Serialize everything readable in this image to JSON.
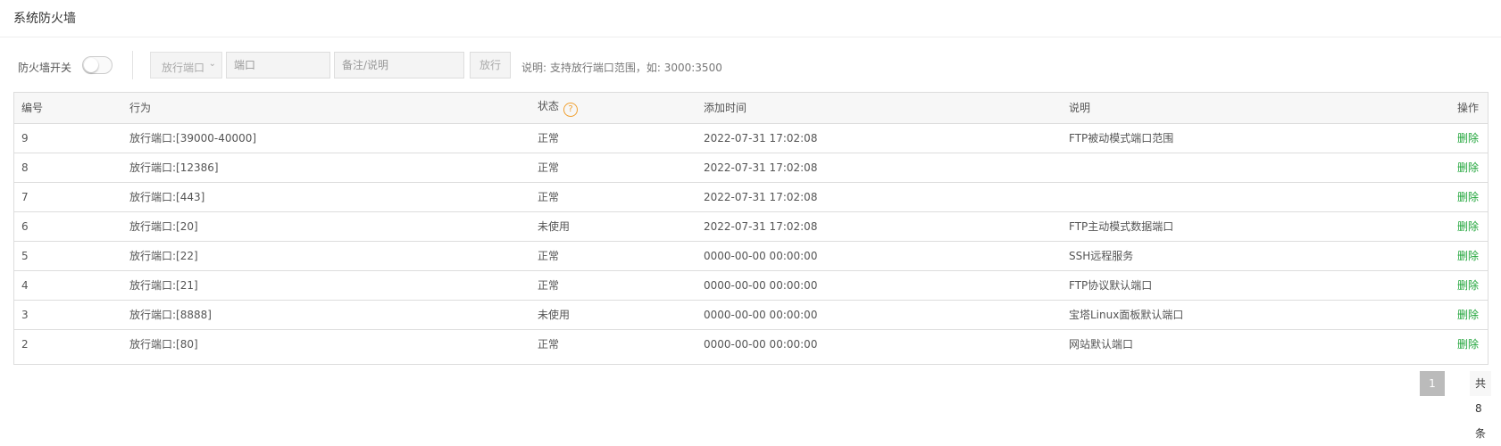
{
  "page_title": "系统防火墙",
  "toolbar": {
    "firewall_switch_label": "防火墙开关",
    "firewall_enabled": false,
    "action_select_value": "放行端口",
    "port_placeholder": "端口",
    "note_placeholder": "备注/说明",
    "release_button": "放行",
    "hint": "说明: 支持放行端口范围，如: 3000:3500"
  },
  "table": {
    "headers": {
      "id": "编号",
      "action": "行为",
      "status": "状态",
      "added_time": "添加时间",
      "description": "说明",
      "operation": "操作"
    },
    "rows": [
      {
        "id": "9",
        "action": "放行端口:[39000-40000]",
        "status": "正常",
        "time": "2022-07-31 17:02:08",
        "desc": "FTP被动模式端口范围",
        "op": "删除"
      },
      {
        "id": "8",
        "action": "放行端口:[12386]",
        "status": "正常",
        "time": "2022-07-31 17:02:08",
        "desc": "",
        "op": "删除"
      },
      {
        "id": "7",
        "action": "放行端口:[443]",
        "status": "正常",
        "time": "2022-07-31 17:02:08",
        "desc": "",
        "op": "删除"
      },
      {
        "id": "6",
        "action": "放行端口:[20]",
        "status": "未使用",
        "time": "2022-07-31 17:02:08",
        "desc": "FTP主动模式数据端口",
        "op": "删除"
      },
      {
        "id": "5",
        "action": "放行端口:[22]",
        "status": "正常",
        "time": "0000-00-00 00:00:00",
        "desc": "SSH远程服务",
        "op": "删除"
      },
      {
        "id": "4",
        "action": "放行端口:[21]",
        "status": "正常",
        "time": "0000-00-00 00:00:00",
        "desc": "FTP协议默认端口",
        "op": "删除"
      },
      {
        "id": "3",
        "action": "放行端口:[8888]",
        "status": "未使用",
        "time": "0000-00-00 00:00:00",
        "desc": "宝塔Linux面板默认端口",
        "op": "删除"
      },
      {
        "id": "2",
        "action": "放行端口:[80]",
        "status": "正常",
        "time": "0000-00-00 00:00:00",
        "desc": "网站默认端口",
        "op": "删除"
      }
    ]
  },
  "pagination": {
    "current_page": "1",
    "total": "共8条"
  },
  "colors": {
    "accent_green": "#20a53a",
    "help_orange": "#f0a030"
  },
  "icons": {
    "status_help": "question-circle-icon",
    "select_arrow": "chevron-down-icon"
  }
}
